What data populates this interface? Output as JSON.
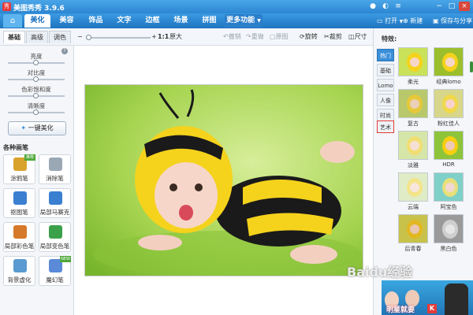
{
  "window": {
    "title": "美图秀秀 3.9.6",
    "logo_glyph": "秀",
    "controls": {
      "minimize": "−",
      "maximize": "□",
      "close": "×"
    }
  },
  "tabs": {
    "home_icon": "home-icon",
    "items": [
      {
        "label": "美化",
        "active": true
      },
      {
        "label": "美容",
        "active": false
      },
      {
        "label": "饰品",
        "active": false
      },
      {
        "label": "文字",
        "active": false
      },
      {
        "label": "边框",
        "active": false
      },
      {
        "label": "场景",
        "active": false
      },
      {
        "label": "拼图",
        "active": false
      },
      {
        "label": "更多功能",
        "active": false
      }
    ],
    "more_caret": "▼",
    "actions": {
      "open": "打开",
      "open_caret": "▼",
      "new": "新建",
      "save_share": "保存与分享"
    }
  },
  "edit_tabs": {
    "basic": "基础",
    "advanced": "高级",
    "color": "调色"
  },
  "toolbar": {
    "zoom_out": "−",
    "zoom_in": "+",
    "actual_size_glyph": "1:1",
    "actual_size": "原大",
    "undo": "撤销",
    "redo": "重做",
    "original": "原图",
    "rotate": "旋转",
    "crop": "裁剪",
    "size": "尺寸"
  },
  "left_panel": {
    "adjustments": [
      {
        "label": "亮度",
        "value": 0.5
      },
      {
        "label": "对比度",
        "value": 0.5
      },
      {
        "label": "色彩饱和度",
        "value": 0.5
      },
      {
        "label": "清晰度",
        "value": 0.5
      }
    ],
    "info_icon": "help-icon",
    "one_click_label": "一键美化",
    "brush_heading": "各种画笔",
    "tools": [
      {
        "label": "涂鸦笔",
        "icon": "doodle-pen-icon",
        "color": "#d9a22b",
        "badge": "推荐"
      },
      {
        "label": "消除笔",
        "icon": "eraser-pen-icon",
        "color": "#9aa8b6",
        "badge": ""
      },
      {
        "label": "抠图笔",
        "icon": "cutout-pen-icon",
        "color": "#3a7fd0",
        "badge": ""
      },
      {
        "label": "局部马赛克",
        "icon": "mosaic-icon",
        "color": "#3a7fd0",
        "badge": ""
      },
      {
        "label": "局部彩色笔",
        "icon": "color-brush-icon",
        "color": "#d57a2a",
        "badge": ""
      },
      {
        "label": "局部变色笔",
        "icon": "recolor-pen-icon",
        "color": "#3aa04a",
        "badge": ""
      },
      {
        "label": "背景虚化",
        "icon": "blur-background-icon",
        "color": "#5a9ad0",
        "badge": ""
      },
      {
        "label": "魔幻笔",
        "icon": "magic-pen-icon",
        "color": "#5a8ad8",
        "badge": "NEW"
      }
    ]
  },
  "right_panel": {
    "title": "特效:",
    "categories": [
      {
        "label": "热门",
        "active": true,
        "outlined": false
      },
      {
        "label": "基础",
        "active": false,
        "outlined": false
      },
      {
        "label": "Lomo",
        "active": false,
        "outlined": false
      },
      {
        "label": "人像",
        "active": false,
        "outlined": false
      },
      {
        "label": "时尚",
        "active": false,
        "outlined": false
      },
      {
        "label": "艺术",
        "active": false,
        "outlined": true
      }
    ],
    "effects": [
      {
        "label": "柔光",
        "tint": "#c9e25a"
      },
      {
        "label": "经典lomo",
        "tint": "#9bbf2c"
      },
      {
        "label": "复古",
        "tint": "#b8c86a"
      },
      {
        "label": "粉红佳人",
        "tint": "#d7d68a"
      },
      {
        "label": "淡雅",
        "tint": "#d6e6a8"
      },
      {
        "label": "HDR",
        "tint": "#8ec43a"
      },
      {
        "label": "云端",
        "tint": "#e0ecc6"
      },
      {
        "label": "阿宝色",
        "tint": "#7fd0c8"
      },
      {
        "label": "后青春",
        "tint": "#c8c24a"
      },
      {
        "label": "黑白色",
        "tint": "#9a9a9a"
      }
    ],
    "ad_text": "明星就要",
    "ad_mark": "K"
  },
  "watermark": "Baidu经验",
  "colors": {
    "brand": "#2c86d2",
    "accent": "#e53b3b"
  }
}
